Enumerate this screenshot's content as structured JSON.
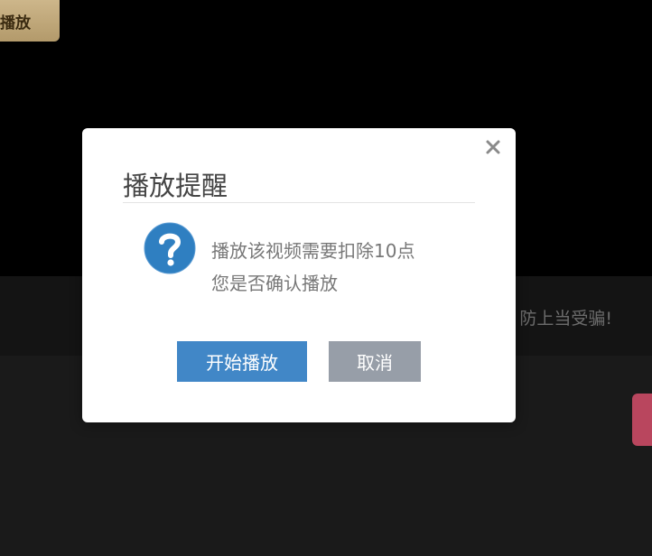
{
  "background": {
    "play_button_label": "播放",
    "notice_text": "防上当受骗!"
  },
  "dialog": {
    "title": "播放提醒",
    "message_line1": "播放该视频需要扣除10点",
    "message_line2": "您是否确认播放",
    "confirm_label": "开始播放",
    "cancel_label": "取消",
    "close_icon": "close-icon",
    "info_icon": "question-icon"
  },
  "colors": {
    "confirm": "#4187c7",
    "cancel": "#979ea8",
    "icon_blue": "#2f7fc1",
    "side_tab": "#b9465e"
  }
}
